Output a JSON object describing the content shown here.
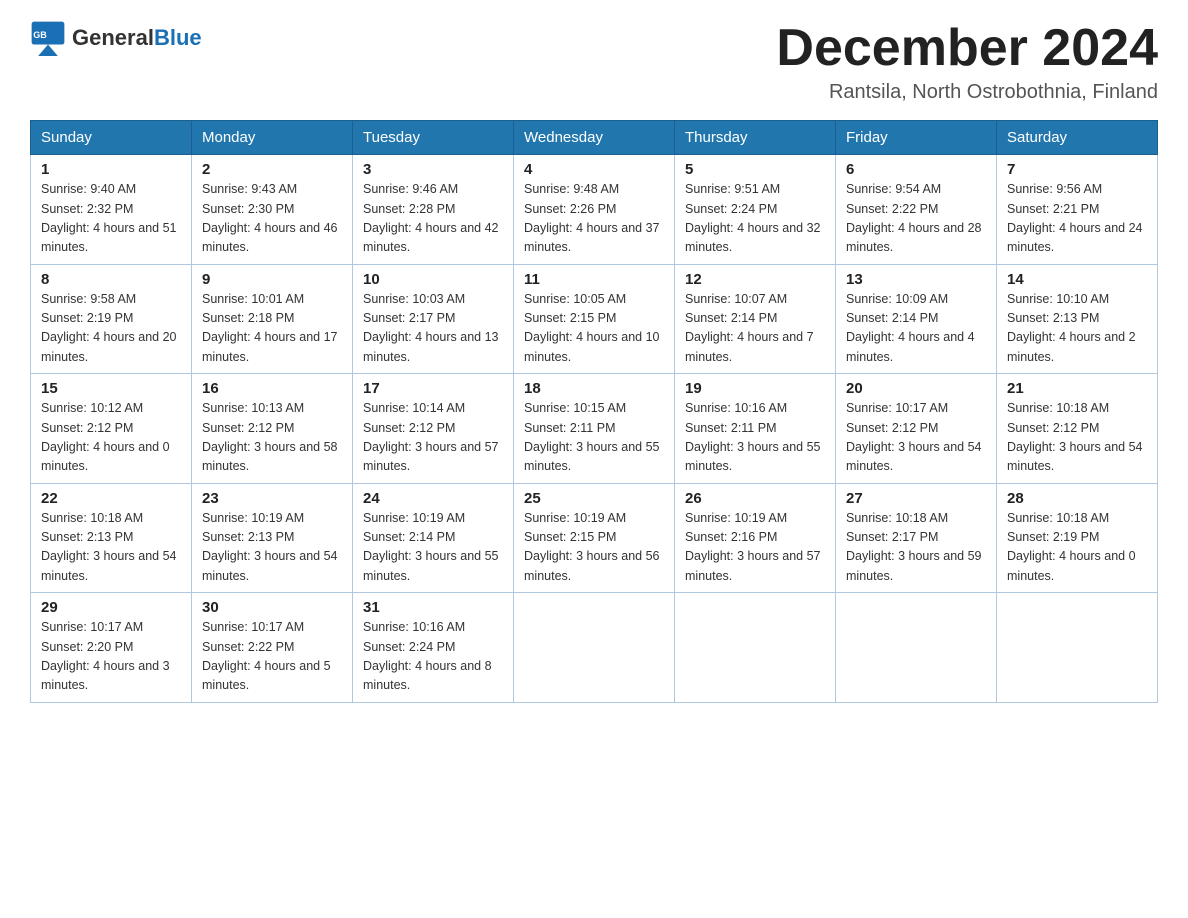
{
  "header": {
    "logo_text_general": "General",
    "logo_text_blue": "Blue",
    "month_title": "December 2024",
    "location": "Rantsila, North Ostrobothnia, Finland"
  },
  "days_of_week": [
    "Sunday",
    "Monday",
    "Tuesday",
    "Wednesday",
    "Thursday",
    "Friday",
    "Saturday"
  ],
  "weeks": [
    [
      {
        "day": "1",
        "sunrise": "9:40 AM",
        "sunset": "2:32 PM",
        "daylight": "4 hours and 51 minutes."
      },
      {
        "day": "2",
        "sunrise": "9:43 AM",
        "sunset": "2:30 PM",
        "daylight": "4 hours and 46 minutes."
      },
      {
        "day": "3",
        "sunrise": "9:46 AM",
        "sunset": "2:28 PM",
        "daylight": "4 hours and 42 minutes."
      },
      {
        "day": "4",
        "sunrise": "9:48 AM",
        "sunset": "2:26 PM",
        "daylight": "4 hours and 37 minutes."
      },
      {
        "day": "5",
        "sunrise": "9:51 AM",
        "sunset": "2:24 PM",
        "daylight": "4 hours and 32 minutes."
      },
      {
        "day": "6",
        "sunrise": "9:54 AM",
        "sunset": "2:22 PM",
        "daylight": "4 hours and 28 minutes."
      },
      {
        "day": "7",
        "sunrise": "9:56 AM",
        "sunset": "2:21 PM",
        "daylight": "4 hours and 24 minutes."
      }
    ],
    [
      {
        "day": "8",
        "sunrise": "9:58 AM",
        "sunset": "2:19 PM",
        "daylight": "4 hours and 20 minutes."
      },
      {
        "day": "9",
        "sunrise": "10:01 AM",
        "sunset": "2:18 PM",
        "daylight": "4 hours and 17 minutes."
      },
      {
        "day": "10",
        "sunrise": "10:03 AM",
        "sunset": "2:17 PM",
        "daylight": "4 hours and 13 minutes."
      },
      {
        "day": "11",
        "sunrise": "10:05 AM",
        "sunset": "2:15 PM",
        "daylight": "4 hours and 10 minutes."
      },
      {
        "day": "12",
        "sunrise": "10:07 AM",
        "sunset": "2:14 PM",
        "daylight": "4 hours and 7 minutes."
      },
      {
        "day": "13",
        "sunrise": "10:09 AM",
        "sunset": "2:14 PM",
        "daylight": "4 hours and 4 minutes."
      },
      {
        "day": "14",
        "sunrise": "10:10 AM",
        "sunset": "2:13 PM",
        "daylight": "4 hours and 2 minutes."
      }
    ],
    [
      {
        "day": "15",
        "sunrise": "10:12 AM",
        "sunset": "2:12 PM",
        "daylight": "4 hours and 0 minutes."
      },
      {
        "day": "16",
        "sunrise": "10:13 AM",
        "sunset": "2:12 PM",
        "daylight": "3 hours and 58 minutes."
      },
      {
        "day": "17",
        "sunrise": "10:14 AM",
        "sunset": "2:12 PM",
        "daylight": "3 hours and 57 minutes."
      },
      {
        "day": "18",
        "sunrise": "10:15 AM",
        "sunset": "2:11 PM",
        "daylight": "3 hours and 55 minutes."
      },
      {
        "day": "19",
        "sunrise": "10:16 AM",
        "sunset": "2:11 PM",
        "daylight": "3 hours and 55 minutes."
      },
      {
        "day": "20",
        "sunrise": "10:17 AM",
        "sunset": "2:12 PM",
        "daylight": "3 hours and 54 minutes."
      },
      {
        "day": "21",
        "sunrise": "10:18 AM",
        "sunset": "2:12 PM",
        "daylight": "3 hours and 54 minutes."
      }
    ],
    [
      {
        "day": "22",
        "sunrise": "10:18 AM",
        "sunset": "2:13 PM",
        "daylight": "3 hours and 54 minutes."
      },
      {
        "day": "23",
        "sunrise": "10:19 AM",
        "sunset": "2:13 PM",
        "daylight": "3 hours and 54 minutes."
      },
      {
        "day": "24",
        "sunrise": "10:19 AM",
        "sunset": "2:14 PM",
        "daylight": "3 hours and 55 minutes."
      },
      {
        "day": "25",
        "sunrise": "10:19 AM",
        "sunset": "2:15 PM",
        "daylight": "3 hours and 56 minutes."
      },
      {
        "day": "26",
        "sunrise": "10:19 AM",
        "sunset": "2:16 PM",
        "daylight": "3 hours and 57 minutes."
      },
      {
        "day": "27",
        "sunrise": "10:18 AM",
        "sunset": "2:17 PM",
        "daylight": "3 hours and 59 minutes."
      },
      {
        "day": "28",
        "sunrise": "10:18 AM",
        "sunset": "2:19 PM",
        "daylight": "4 hours and 0 minutes."
      }
    ],
    [
      {
        "day": "29",
        "sunrise": "10:17 AM",
        "sunset": "2:20 PM",
        "daylight": "4 hours and 3 minutes."
      },
      {
        "day": "30",
        "sunrise": "10:17 AM",
        "sunset": "2:22 PM",
        "daylight": "4 hours and 5 minutes."
      },
      {
        "day": "31",
        "sunrise": "10:16 AM",
        "sunset": "2:24 PM",
        "daylight": "4 hours and 8 minutes."
      },
      null,
      null,
      null,
      null
    ]
  ]
}
